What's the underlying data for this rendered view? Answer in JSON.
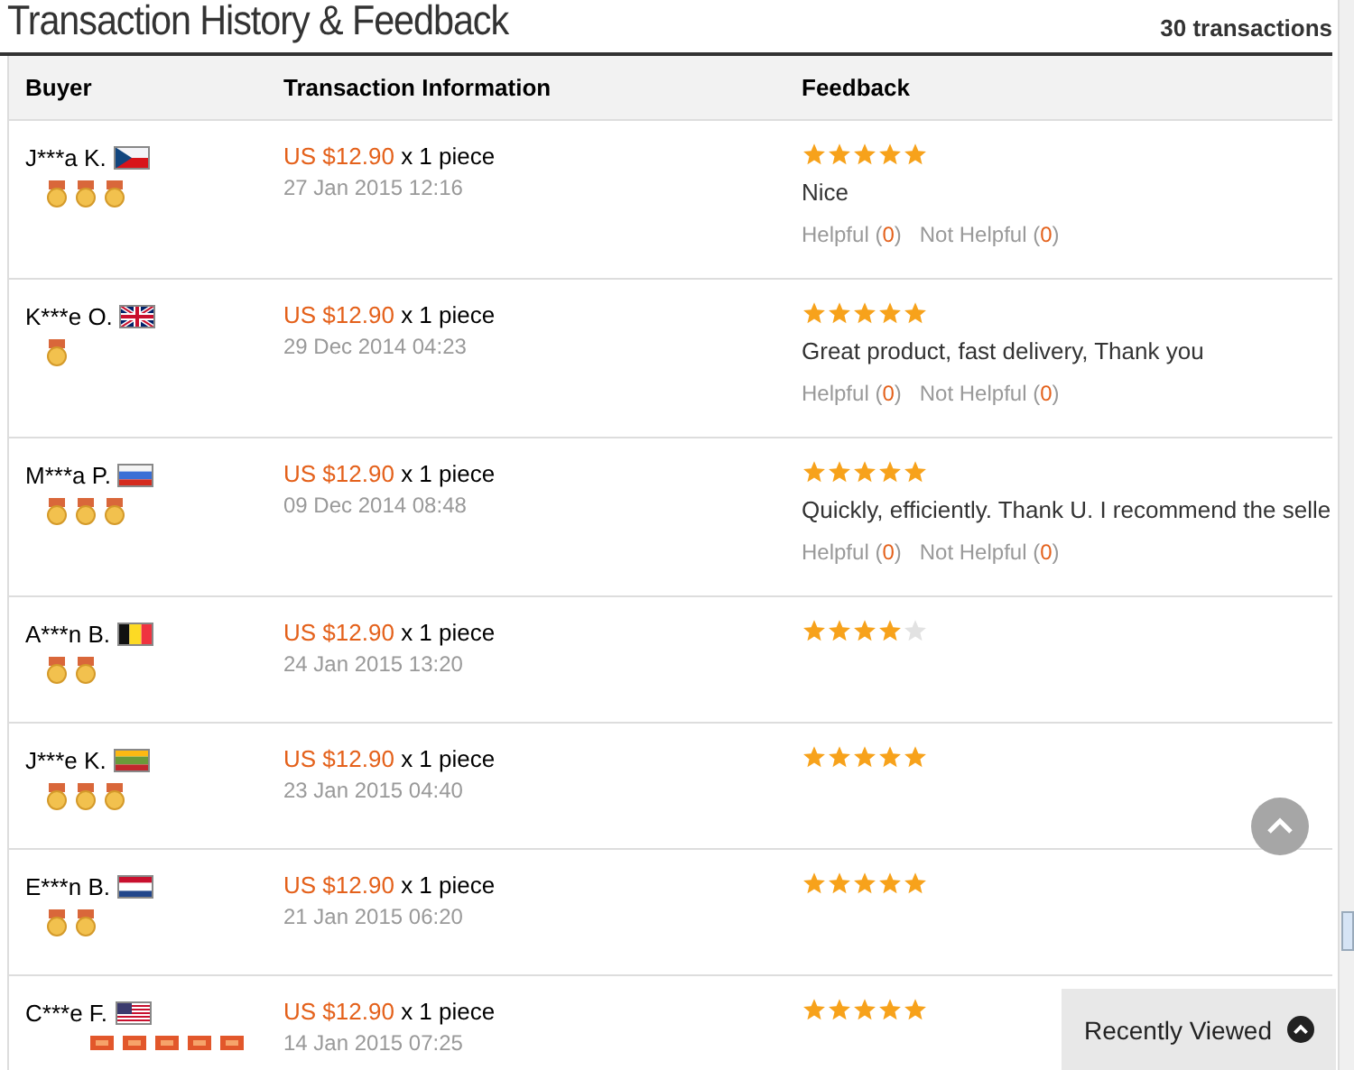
{
  "title": "Transaction History & Feedback",
  "count": "30 transactions",
  "columns": [
    "Buyer",
    "Transaction Information",
    "Feedback"
  ],
  "rows": [
    {
      "buyer": "J***a K.",
      "flag": {
        "kind": "cz"
      },
      "badges": [
        {
          "kind": "medal"
        },
        {
          "kind": "medal"
        },
        {
          "kind": "medal"
        }
      ],
      "price": "US $12.90",
      "qty": "x 1 piece",
      "date": "27 Jan 2015 12:16",
      "stars": 5,
      "comment": "Nice",
      "helpful": {
        "label": "Helpful (",
        "count": "0",
        "close": ")"
      },
      "not_helpful": {
        "label": "Not Helpful (",
        "count": "0",
        "close": ")"
      }
    },
    {
      "buyer": "K***e O.",
      "flag": {
        "kind": "uk"
      },
      "badges": [
        {
          "kind": "medal"
        }
      ],
      "price": "US $12.90",
      "qty": "x 1 piece",
      "date": "29 Dec 2014 04:23",
      "stars": 5,
      "comment": "Great product, fast delivery, Thank you",
      "helpful": {
        "label": "Helpful (",
        "count": "0",
        "close": ")"
      },
      "not_helpful": {
        "label": "Not Helpful (",
        "count": "0",
        "close": ")"
      }
    },
    {
      "buyer": "M***a P.",
      "flag": {
        "kind": "ru"
      },
      "badges": [
        {
          "kind": "medal"
        },
        {
          "kind": "medal"
        },
        {
          "kind": "medal"
        }
      ],
      "price": "US $12.90",
      "qty": "x 1 piece",
      "date": "09 Dec 2014 08:48",
      "stars": 5,
      "comment": "Quickly, efficiently. Thank U. I recommend the selle",
      "helpful": {
        "label": "Helpful (",
        "count": "0",
        "close": ")"
      },
      "not_helpful": {
        "label": "Not Helpful (",
        "count": "0",
        "close": ")"
      }
    },
    {
      "buyer": "A***n B.",
      "flag": {
        "kind": "be"
      },
      "badges": [
        {
          "kind": "medal"
        },
        {
          "kind": "medal"
        }
      ],
      "price": "US $12.90",
      "qty": "x 1 piece",
      "date": "24 Jan 2015 13:20",
      "stars": 4
    },
    {
      "buyer": "J***e K.",
      "flag": {
        "kind": "lt"
      },
      "badges": [
        {
          "kind": "medal"
        },
        {
          "kind": "medal"
        },
        {
          "kind": "medal"
        }
      ],
      "price": "US $12.90",
      "qty": "x 1 piece",
      "date": "23 Jan 2015 04:40",
      "stars": 5
    },
    {
      "buyer": "E***n B.",
      "flag": {
        "kind": "nl"
      },
      "badges": [
        {
          "kind": "medal"
        },
        {
          "kind": "medal"
        }
      ],
      "price": "US $12.90",
      "qty": "x 1 piece",
      "date": "21 Jan 2015 06:20",
      "stars": 5
    },
    {
      "buyer": "C***e F.",
      "flag": {
        "kind": "us"
      },
      "badges": [
        {
          "kind": "crown"
        },
        {
          "kind": "crown"
        },
        {
          "kind": "crown"
        },
        {
          "kind": "crown"
        },
        {
          "kind": "crown"
        }
      ],
      "price": "US $12.90",
      "qty": "x 1 piece",
      "date": "14 Jan 2015 07:25",
      "stars": 5
    }
  ],
  "recently_viewed": "Recently Viewed"
}
